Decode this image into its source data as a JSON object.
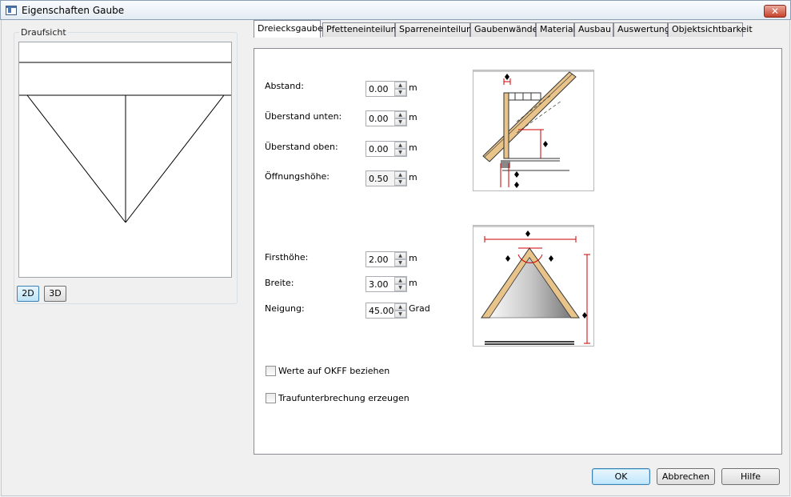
{
  "window": {
    "title": "Eigenschaften Gaube",
    "close_glyph": "✕"
  },
  "left": {
    "group_label": "Draufsicht",
    "btn_2d": "2D",
    "btn_3d": "3D"
  },
  "tabs": [
    {
      "label": "Dreiecksgaube",
      "selected": true
    },
    {
      "label": "Pfetteneinteilung"
    },
    {
      "label": "Sparreneinteilung"
    },
    {
      "label": "Gaubenwände"
    },
    {
      "label": "Material"
    },
    {
      "label": "Ausbau"
    },
    {
      "label": "Auswertung"
    },
    {
      "label": "Objektsichtbarkeit"
    }
  ],
  "fields": {
    "abstand": {
      "label": "Abstand:",
      "value": "0.00",
      "unit": "m"
    },
    "ueberstand_unten": {
      "label": "Überstand unten:",
      "value": "0.00",
      "unit": "m"
    },
    "ueberstand_oben": {
      "label": "Überstand oben:",
      "value": "0.00",
      "unit": "m"
    },
    "oeffnungshoehe": {
      "label": "Öffnungshöhe:",
      "value": "0.50",
      "unit": "m"
    },
    "firsthoehe": {
      "label": "Firsthöhe:",
      "value": "2.00",
      "unit": "m"
    },
    "breite": {
      "label": "Breite:",
      "value": "3.00",
      "unit": "m"
    },
    "neigung": {
      "label": "Neigung:",
      "value": "45.00",
      "unit": "Grad"
    }
  },
  "checkboxes": {
    "okff": {
      "label": "Werte auf OKFF beziehen",
      "checked": false
    },
    "traufe": {
      "label": "Traufunterbrechung erzeugen",
      "checked": false
    }
  },
  "buttons": {
    "ok": "OK",
    "cancel": "Abbrechen",
    "help": "Hilfe"
  },
  "colors": {
    "wood": "#e8c38a",
    "dimension": "#cc0000",
    "accent": "#3c7fb1"
  }
}
